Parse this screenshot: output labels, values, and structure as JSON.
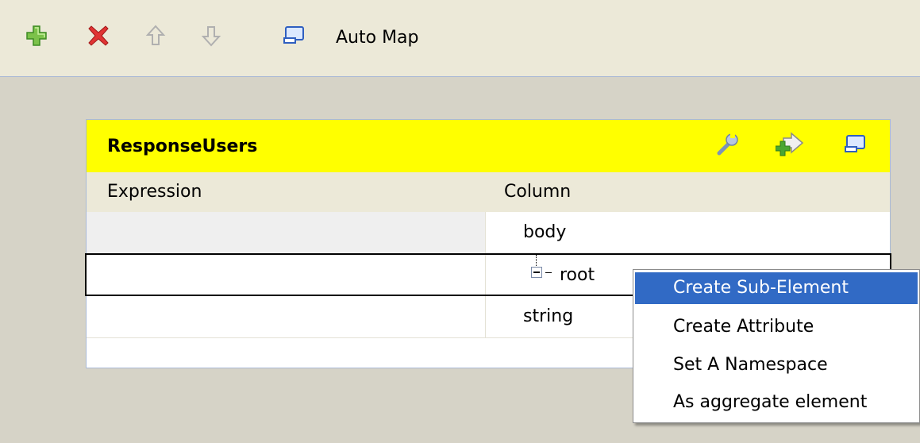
{
  "toolbar": {
    "buttons": [
      {
        "name": "add",
        "icon": "plus-icon",
        "color": "#3aa02a"
      },
      {
        "name": "remove",
        "icon": "red-x-icon",
        "color": "#d22020"
      },
      {
        "name": "move-up",
        "icon": "arrow-up-icon",
        "color": "#b8b8b8"
      },
      {
        "name": "move-down",
        "icon": "arrow-down-icon",
        "color": "#b8b8b8"
      },
      {
        "name": "auto-map",
        "icon": "monitor-icon",
        "color": "#2f5fc0"
      }
    ],
    "auto_map_label": "Auto Map"
  },
  "panel": {
    "title": "ResponseUsers",
    "header_color": "#ffff00",
    "header_icons": [
      "wrench-icon",
      "add-row-arrow-icon",
      "monitor-icon"
    ],
    "columns": {
      "expression": "Expression",
      "column": "Column"
    },
    "rows": [
      {
        "expression": "",
        "column": "body"
      },
      {
        "expression": "",
        "column": "root"
      },
      {
        "expression": "",
        "column": "string"
      }
    ]
  },
  "context_menu": {
    "items": [
      {
        "label": "Create Sub-Element",
        "selected": true
      },
      {
        "label": "Create Attribute",
        "selected": false
      },
      {
        "label": "Set A Namespace",
        "selected": false
      },
      {
        "label": "As aggregate element",
        "selected": false
      }
    ],
    "highlight_color": "#316ac5"
  }
}
